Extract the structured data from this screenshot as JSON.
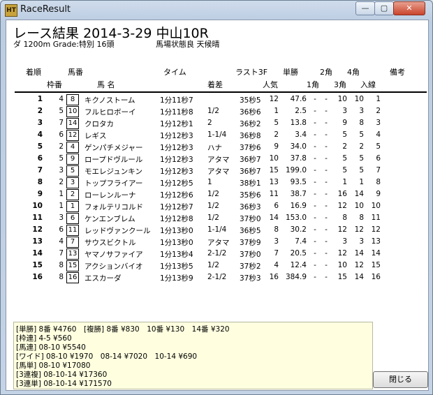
{
  "window": {
    "title": "RaceResult",
    "icon_text": "HT",
    "min_glyph": "—",
    "max_glyph": "▢",
    "close_glyph": "✕"
  },
  "header": {
    "title": "レース結果 2014-3-29 中山10R",
    "info": "ダ 1200m Grade:特別 16頭",
    "conditions": "馬場状態良 天候晴"
  },
  "columns": {
    "row1": [
      "着順",
      "馬番",
      "タイム",
      "ラスト3F",
      "単勝",
      "2角",
      "4角",
      "備考"
    ],
    "row2": [
      "枠番",
      "馬 名",
      "着差",
      "人気",
      "1角",
      "3角",
      "入線"
    ]
  },
  "results": [
    {
      "rank": "1",
      "waku": "4",
      "umaban": "8",
      "name": "キクノストーム",
      "time": "1分11秒7",
      "margin": "",
      "last3f": "35秒5",
      "pop": "12",
      "odds": "47.6",
      "c1": "-",
      "c2": "-",
      "c3": "10",
      "c4": "10",
      "finish": "1"
    },
    {
      "rank": "2",
      "waku": "5",
      "umaban": "10",
      "name": "フルヒロボーイ",
      "time": "1分11秒8",
      "margin": "1/2",
      "last3f": "36秒6",
      "pop": "1",
      "odds": "2.5",
      "c1": "-",
      "c2": "-",
      "c3": "3",
      "c4": "3",
      "finish": "2"
    },
    {
      "rank": "3",
      "waku": "7",
      "umaban": "14",
      "name": "クロタカ",
      "time": "1分12秒1",
      "margin": "2",
      "last3f": "36秒2",
      "pop": "5",
      "odds": "13.8",
      "c1": "-",
      "c2": "-",
      "c3": "9",
      "c4": "8",
      "finish": "3"
    },
    {
      "rank": "4",
      "waku": "6",
      "umaban": "12",
      "name": "レギス",
      "time": "1分12秒3",
      "margin": "1-1/4",
      "last3f": "36秒8",
      "pop": "2",
      "odds": "3.4",
      "c1": "-",
      "c2": "-",
      "c3": "5",
      "c4": "5",
      "finish": "4"
    },
    {
      "rank": "5",
      "waku": "2",
      "umaban": "4",
      "name": "ゲンパチメジャー",
      "time": "1分12秒3",
      "margin": "ハナ",
      "last3f": "37秒6",
      "pop": "9",
      "odds": "34.0",
      "c1": "-",
      "c2": "-",
      "c3": "2",
      "c4": "2",
      "finish": "5"
    },
    {
      "rank": "6",
      "waku": "5",
      "umaban": "9",
      "name": "ロープドヴルール",
      "time": "1分12秒3",
      "margin": "アタマ",
      "last3f": "36秒7",
      "pop": "10",
      "odds": "37.8",
      "c1": "-",
      "c2": "-",
      "c3": "5",
      "c4": "5",
      "finish": "6"
    },
    {
      "rank": "7",
      "waku": "3",
      "umaban": "5",
      "name": "モエレジュンキン",
      "time": "1分12秒3",
      "margin": "アタマ",
      "last3f": "36秒7",
      "pop": "15",
      "odds": "199.0",
      "c1": "-",
      "c2": "-",
      "c3": "5",
      "c4": "5",
      "finish": "7"
    },
    {
      "rank": "8",
      "waku": "2",
      "umaban": "3",
      "name": "トップフライアー",
      "time": "1分12秒5",
      "margin": "1",
      "last3f": "38秒1",
      "pop": "13",
      "odds": "93.5",
      "c1": "-",
      "c2": "-",
      "c3": "1",
      "c4": "1",
      "finish": "8"
    },
    {
      "rank": "9",
      "waku": "1",
      "umaban": "2",
      "name": "ローレンルーナ",
      "time": "1分12秒6",
      "margin": "1/2",
      "last3f": "35秒6",
      "pop": "11",
      "odds": "38.7",
      "c1": "-",
      "c2": "-",
      "c3": "16",
      "c4": "14",
      "finish": "9"
    },
    {
      "rank": "10",
      "waku": "1",
      "umaban": "1",
      "name": "フォルテリコルド",
      "time": "1分12秒7",
      "margin": "1/2",
      "last3f": "36秒3",
      "pop": "6",
      "odds": "16.9",
      "c1": "-",
      "c2": "-",
      "c3": "12",
      "c4": "10",
      "finish": "10"
    },
    {
      "rank": "11",
      "waku": "3",
      "umaban": "6",
      "name": "ケンエンブレム",
      "time": "1分12秒8",
      "margin": "1/2",
      "last3f": "37秒0",
      "pop": "14",
      "odds": "153.0",
      "c1": "-",
      "c2": "-",
      "c3": "8",
      "c4": "8",
      "finish": "11"
    },
    {
      "rank": "12",
      "waku": "6",
      "umaban": "11",
      "name": "レッドヴァンクール",
      "time": "1分13秒0",
      "margin": "1-1/4",
      "last3f": "36秒5",
      "pop": "8",
      "odds": "30.2",
      "c1": "-",
      "c2": "-",
      "c3": "12",
      "c4": "12",
      "finish": "12"
    },
    {
      "rank": "13",
      "waku": "4",
      "umaban": "7",
      "name": "サウスビクトル",
      "time": "1分13秒0",
      "margin": "アタマ",
      "last3f": "37秒9",
      "pop": "3",
      "odds": "7.4",
      "c1": "-",
      "c2": "-",
      "c3": "3",
      "c4": "3",
      "finish": "13"
    },
    {
      "rank": "14",
      "waku": "7",
      "umaban": "13",
      "name": "ヤマノサファイア",
      "time": "1分13秒4",
      "margin": "2-1/2",
      "last3f": "37秒0",
      "pop": "7",
      "odds": "20.5",
      "c1": "-",
      "c2": "-",
      "c3": "12",
      "c4": "14",
      "finish": "14"
    },
    {
      "rank": "15",
      "waku": "8",
      "umaban": "15",
      "name": "アクションバイオ",
      "time": "1分13秒5",
      "margin": "1/2",
      "last3f": "37秒2",
      "pop": "4",
      "odds": "12.4",
      "c1": "-",
      "c2": "-",
      "c3": "10",
      "c4": "12",
      "finish": "15"
    },
    {
      "rank": "16",
      "waku": "8",
      "umaban": "16",
      "name": "エスカーダ",
      "time": "1分13秒9",
      "margin": "2-1/2",
      "last3f": "37秒3",
      "pop": "16",
      "odds": "384.9",
      "c1": "-",
      "c2": "-",
      "c3": "15",
      "c4": "14",
      "finish": "16"
    }
  ],
  "payouts": [
    "[単勝] 8番 ¥4760　[複勝] 8番 ¥830　10番 ¥130　14番 ¥320",
    "[枠連] 4-5 ¥560",
    "[馬連] 08-10 ¥5540",
    "[ワイド] 08-10 ¥1970　08-14 ¥7020　10-14 ¥690",
    "[馬単] 08-10 ¥17080",
    "[3連複] 08-10-14 ¥17360",
    "[3連単] 08-10-14 ¥171570"
  ],
  "buttons": {
    "close_label": "閉じる"
  }
}
